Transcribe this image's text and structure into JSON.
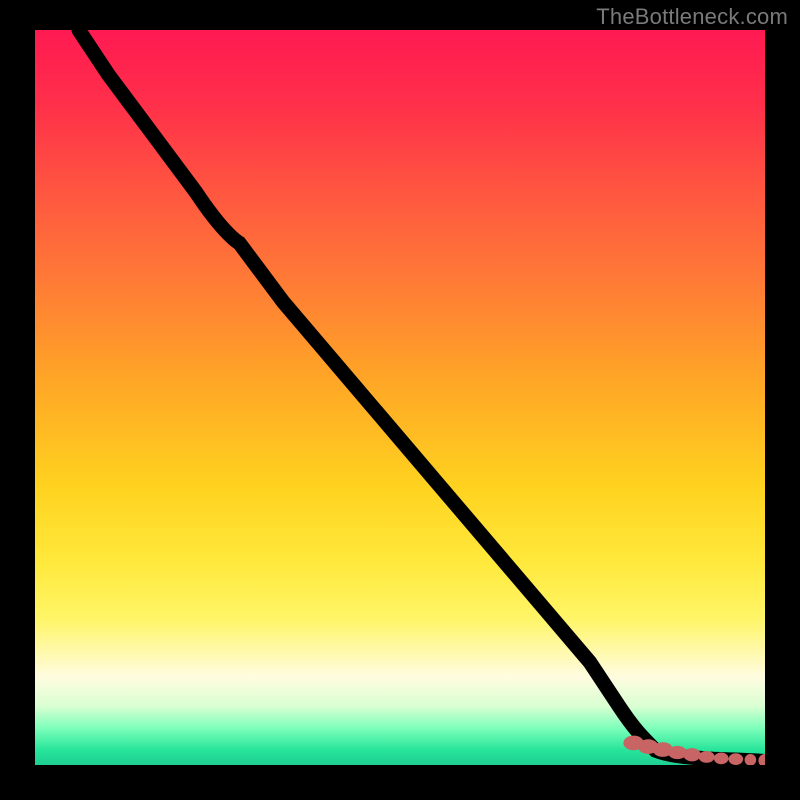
{
  "watermark": {
    "text": "TheBottleneck.com"
  },
  "colors": {
    "background": "#000000",
    "watermark_text": "#7a7a7a",
    "marker": "#c86464",
    "line": "#000000",
    "gradient": [
      "#ff1a52",
      "#ff7a36",
      "#ffd21f",
      "#fffce0",
      "#26e49a"
    ]
  },
  "chart_data": {
    "type": "line",
    "title": "",
    "xlabel": "",
    "ylabel": "",
    "xlim": [
      0,
      100
    ],
    "ylim": [
      0,
      100
    ],
    "grid": false,
    "legend": false,
    "series": [
      {
        "name": "main-curve",
        "x": [
          6,
          10,
          16,
          22,
          28,
          34,
          40,
          46,
          52,
          58,
          64,
          70,
          76,
          80,
          83,
          85,
          87,
          89,
          91,
          93,
          95,
          97,
          100
        ],
        "y": [
          100,
          94,
          86,
          78,
          71,
          63,
          56,
          49,
          42,
          35,
          28,
          21,
          14,
          8,
          4,
          2,
          1.5,
          1.2,
          1.0,
          0.8,
          0.7,
          0.6,
          0.5
        ]
      }
    ],
    "markers": {
      "name": "bottom-markers",
      "x": [
        82,
        84,
        86,
        88,
        90,
        92,
        94,
        96,
        98,
        100
      ],
      "y": [
        3.0,
        2.5,
        2.1,
        1.7,
        1.4,
        1.1,
        0.9,
        0.8,
        0.7,
        0.6
      ]
    },
    "background_gradient_axis": "y",
    "background_gradient_desc": "red (top) through orange/yellow to green (bottom)"
  }
}
